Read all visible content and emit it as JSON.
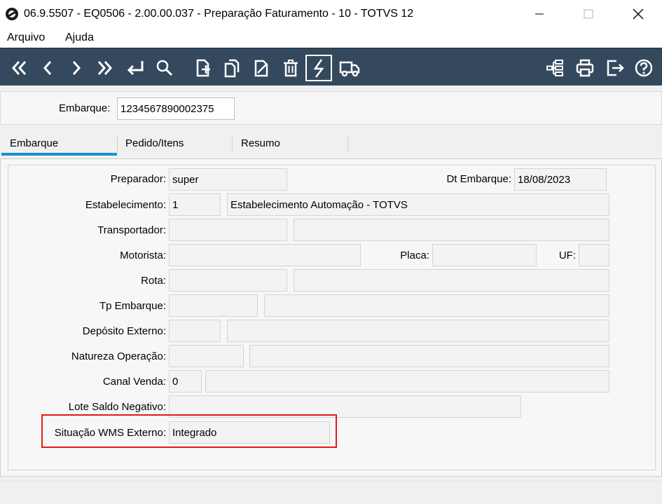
{
  "window": {
    "title": "06.9.5507 - EQ0506 - 2.00.00.037 - Preparação Faturamento - 10 - TOTVS 12"
  },
  "menu": {
    "items": [
      "Arquivo",
      "Ajuda"
    ]
  },
  "toolbar": {
    "left_icons": [
      "first-icon",
      "previous-icon",
      "next-icon",
      "last-icon",
      "goto-icon",
      "search-icon",
      "new-icon",
      "copy-icon",
      "edit-icon",
      "delete-icon",
      "execute-icon",
      "truck-icon"
    ],
    "right_icons": [
      "navigation-tree-icon",
      "print-icon",
      "exit-icon",
      "help-icon"
    ],
    "active": "execute-icon",
    "colors": {
      "background": "#34495e",
      "icon": "#ffffff"
    }
  },
  "header": {
    "embarque_label": "Embarque:",
    "embarque_value": "1234567890002375"
  },
  "tabs": {
    "items": [
      "Embarque",
      "Pedido/Itens",
      "Resumo"
    ],
    "active": "Embarque",
    "accent_color": "#1a8fd6"
  },
  "form": {
    "preparador": {
      "label": "Preparador:",
      "value": "super"
    },
    "dt_embarque": {
      "label": "Dt Embarque:",
      "value": "18/08/2023"
    },
    "estabelecimento": {
      "label": "Estabelecimento:",
      "code": "1",
      "description": "Estabelecimento Automação - TOTVS"
    },
    "transportador": {
      "label": "Transportador:",
      "code": "",
      "description": ""
    },
    "motorista": {
      "label": "Motorista:",
      "value": ""
    },
    "placa": {
      "label": "Placa:",
      "value": ""
    },
    "uf": {
      "label": "UF:",
      "value": ""
    },
    "rota": {
      "label": "Rota:",
      "code": "",
      "description": ""
    },
    "tp_embarque": {
      "label": "Tp Embarque:",
      "code": "",
      "description": ""
    },
    "deposito_externo": {
      "label": "Depósito Externo:",
      "code": "",
      "description": ""
    },
    "natureza_operacao": {
      "label": "Natureza Operação:",
      "code": "",
      "description": ""
    },
    "canal_venda": {
      "label": "Canal Venda:",
      "code": "0",
      "description": ""
    },
    "lote_saldo_negativo": {
      "label": "Lote Saldo Negativo:",
      "value": ""
    },
    "situacao_wms_externo": {
      "label": "Situação WMS Externo:",
      "value": "Integrado"
    }
  },
  "highlight_color": "#e01b1b"
}
